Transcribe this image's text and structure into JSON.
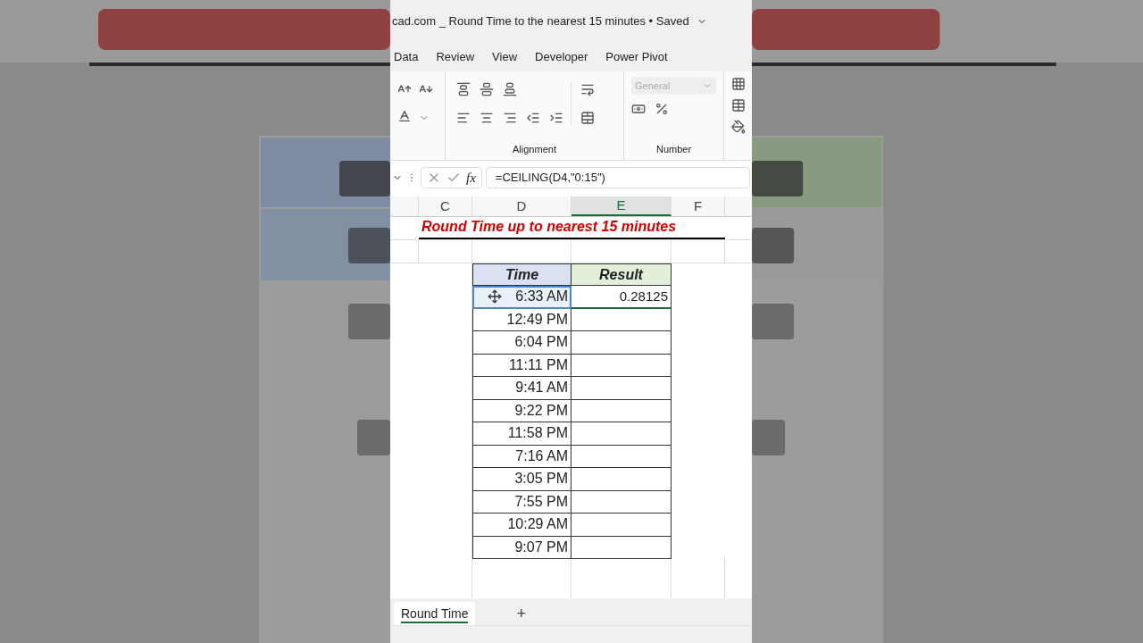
{
  "title": "cad.com _ Round Time to the nearest 15 minutes • Saved",
  "menu_tabs": [
    "Data",
    "Review",
    "View",
    "Developer",
    "Power Pivot"
  ],
  "ribbon": {
    "number_format": "General",
    "groups": [
      "Alignment",
      "Number"
    ]
  },
  "formula_bar": {
    "fx": "fx",
    "formula": "=CEILING(D4,\"0:15\")"
  },
  "columns": [
    {
      "label": "C",
      "selected": false
    },
    {
      "label": "D",
      "selected": false
    },
    {
      "label": "E",
      "selected": true
    },
    {
      "label": "F",
      "selected": false
    }
  ],
  "sheet": {
    "heading": "Round Time up to nearest 15 minutes",
    "table": {
      "columns": [
        "Time",
        "Result"
      ],
      "rows": [
        {
          "time": "6:33 AM",
          "result": "0.28125",
          "selected": true
        },
        {
          "time": "12:49 PM",
          "selected": false
        },
        {
          "time": "6:04 PM",
          "selected": false
        },
        {
          "time": "11:11 PM",
          "selected": false
        },
        {
          "time": "9:41 AM",
          "selected": false
        },
        {
          "time": "9:22 PM",
          "selected": false
        },
        {
          "time": "11:58 PM",
          "selected": false
        },
        {
          "time": "7:16 AM",
          "selected": false
        },
        {
          "time": "3:05 PM",
          "selected": false
        },
        {
          "time": "7:55 PM",
          "selected": false
        },
        {
          "time": "10:29 AM",
          "selected": false
        },
        {
          "time": "9:07 PM",
          "selected": false
        }
      ]
    }
  },
  "sheet_tabs": [
    {
      "label": "Round Time",
      "selected": true
    }
  ],
  "add_sheet": "+"
}
